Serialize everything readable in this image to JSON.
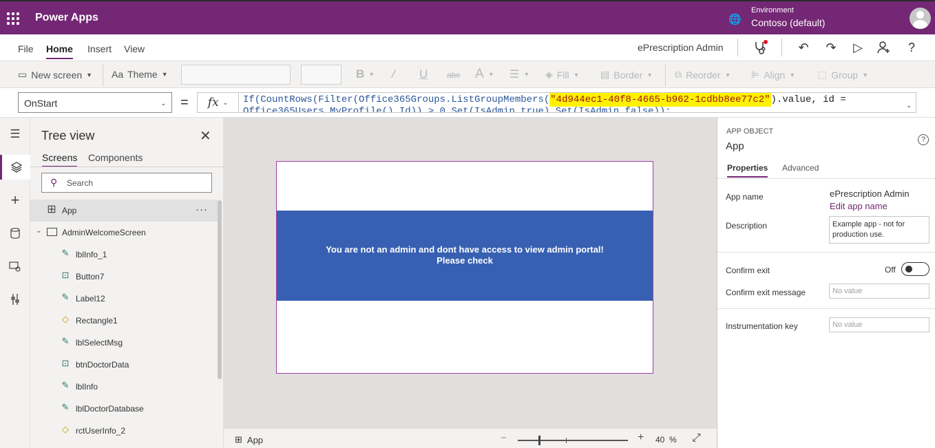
{
  "topbar": {
    "brand": "Power Apps",
    "environment_label": "Environment",
    "environment_name": "Contoso (default)"
  },
  "menu": {
    "items": [
      "File",
      "Home",
      "Insert",
      "View"
    ],
    "active": "Home",
    "app_title": "ePrescription Admin"
  },
  "toolbar": {
    "new_screen": "New screen",
    "theme": "Theme",
    "fill": "Fill",
    "border": "Border",
    "reorder": "Reorder",
    "align": "Align",
    "group": "Group"
  },
  "formula_bar": {
    "property": "OnStart",
    "equals": "=",
    "fx": "fx",
    "line1_prefix": "If(CountRows(Filter(Office365Groups.ListGroupMembers(",
    "line1_string": "\"4d944ec1-40f8-4665-b962-1cdbb8ee77c2\"",
    "line1_suffix": ").value, id =",
    "line2": "Office365Users.MyProfile().Id)) > 0,Set(IsAdmin,true),Set(IsAdmin,false));"
  },
  "treeview": {
    "title": "Tree view",
    "tabs": [
      "Screens",
      "Components"
    ],
    "search_placeholder": "Search",
    "items": [
      {
        "label": "App",
        "icon": "app-icon",
        "level": 0
      },
      {
        "label": "AdminWelcomeScreen",
        "icon": "screen-icon",
        "level": 0
      },
      {
        "label": "lblInfo_1",
        "icon": "label-icon",
        "level": 1
      },
      {
        "label": "Button7",
        "icon": "button-icon",
        "level": 1
      },
      {
        "label": "Label12",
        "icon": "label-icon",
        "level": 1
      },
      {
        "label": "Rectangle1",
        "icon": "shape-icon",
        "level": 1
      },
      {
        "label": "lblSelectMsg",
        "icon": "label-icon",
        "level": 1
      },
      {
        "label": "btnDoctorData",
        "icon": "button-icon",
        "level": 1
      },
      {
        "label": "lblInfo",
        "icon": "label-icon",
        "level": 1
      },
      {
        "label": "lblDoctorDatabase",
        "icon": "label-icon",
        "level": 1
      },
      {
        "label": "rctUserInfo_2",
        "icon": "shape-icon",
        "level": 1
      }
    ]
  },
  "canvas": {
    "message_line1": "You are not an admin and dont have access to view admin portal!",
    "message_line2": "Please check",
    "band_color": "#3760b2"
  },
  "statusbar": {
    "screen": "App",
    "zoom_value": "40",
    "zoom_unit": "%"
  },
  "properties": {
    "kicker": "APP OBJECT",
    "name": "App",
    "tabs": [
      "Properties",
      "Advanced"
    ],
    "app_name_label": "App name",
    "app_name_value": "ePrescription Admin",
    "edit_app_name": "Edit app name",
    "description_label": "Description",
    "description_value": "Example app - not for production use.",
    "confirm_exit_label": "Confirm exit",
    "confirm_exit_state": "Off",
    "confirm_exit_message_label": "Confirm exit message",
    "no_value": "No value",
    "instrumentation_key_label": "Instrumentation key"
  },
  "colors": {
    "brand": "#742774",
    "canvas_bg": "#e1dfdd"
  }
}
